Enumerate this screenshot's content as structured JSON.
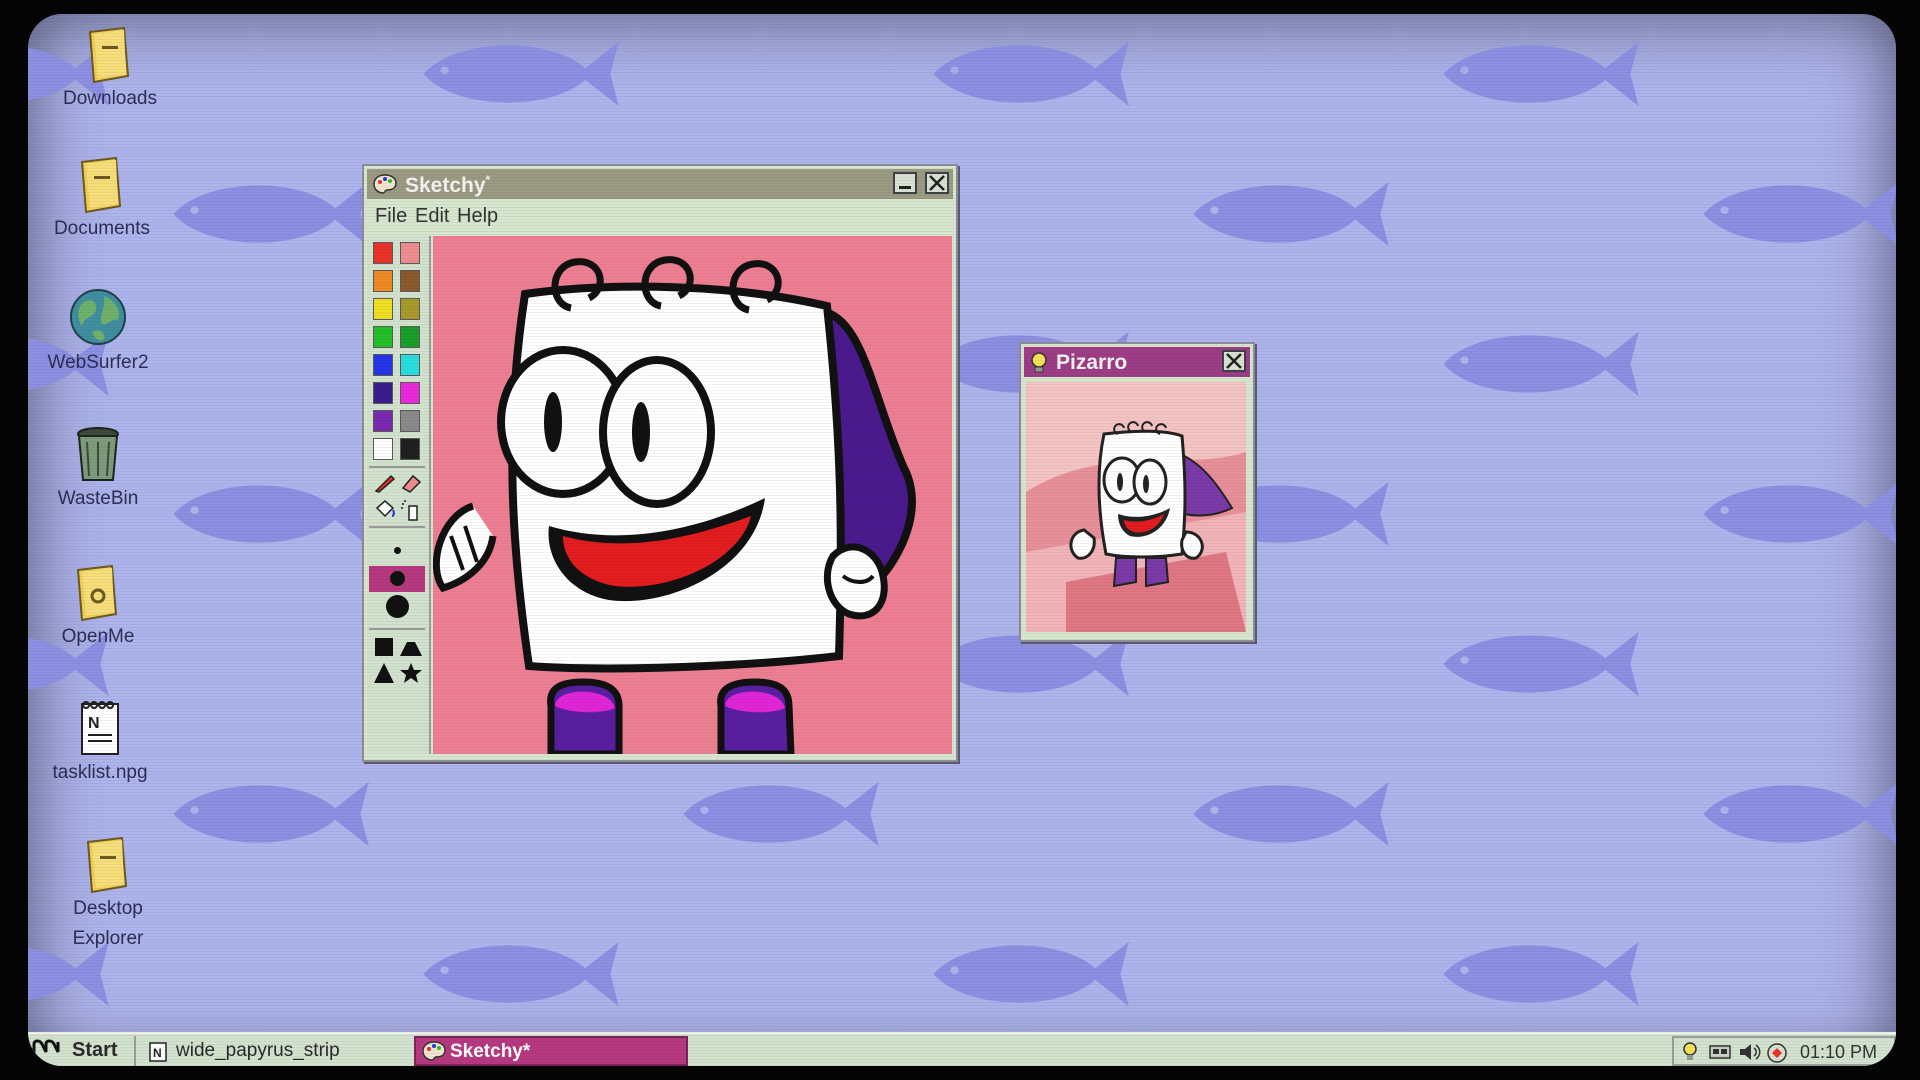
{
  "desktop": {
    "icons": [
      {
        "label": "Downloads",
        "icon": "folder-icon"
      },
      {
        "label": "Documents",
        "icon": "folder-icon"
      },
      {
        "label": "WebSurfer2",
        "icon": "globe-icon"
      },
      {
        "label": "WasteBin",
        "icon": "trash-can-icon"
      },
      {
        "label": "OpenMe",
        "icon": "folder-icon"
      },
      {
        "label": "tasklist.npg",
        "icon": "notepad-icon"
      },
      {
        "label": "Desktop\nExplorer",
        "icon": "folder-icon"
      }
    ]
  },
  "sketchy": {
    "title": "Sketchy",
    "title_mark": "*",
    "menu": [
      "File",
      "Edit",
      "Help"
    ],
    "palette": [
      "#e8322a",
      "#ef8d8f",
      "#f08a23",
      "#8c5a2b",
      "#f0e024",
      "#a89a2a",
      "#24c02a",
      "#17a02a",
      "#2436e8",
      "#28dedf",
      "#3a1c8e",
      "#ea28dc",
      "#7a2ab0",
      "#8a8a8a",
      "#ffffff",
      "#202020"
    ],
    "tools": [
      "pencil-icon",
      "eraser-icon",
      "fill-icon",
      "spray-icon"
    ],
    "brush_sizes": [
      "small",
      "medium",
      "large"
    ],
    "shapes": [
      "square-icon",
      "mountain-icon",
      "triangle-icon",
      "star-icon"
    ]
  },
  "pizarro": {
    "title": "Pizarro",
    "icon": "lightbulb-icon"
  },
  "taskbar": {
    "start_label": "Start",
    "items": [
      {
        "label": "wide_papyrus_strip",
        "icon": "notepad-icon",
        "active": false
      },
      {
        "label": "Sketchy*",
        "icon": "palette-icon",
        "active": true
      }
    ],
    "tray_icons": [
      "lightbulb-icon",
      "video-icon",
      "speaker-icon",
      "network-icon"
    ],
    "clock": "01:10 PM"
  },
  "colors": {
    "desktop_bg": "#aeb4ec",
    "fish": "#8c8fe2",
    "window_body": "#d7e6cf",
    "titlebar_sketchy": "#9b9a82",
    "titlebar_pizarro": "#9c3d86",
    "taskbar_active": "#b5397f",
    "canvas_pink": "#ee7f93"
  }
}
